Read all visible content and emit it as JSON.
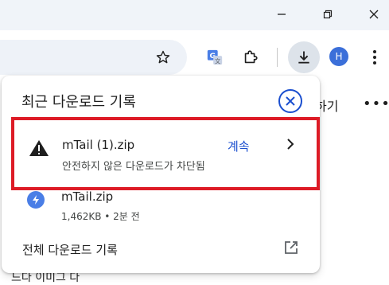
{
  "window": {
    "controls": [
      "minimize",
      "restore",
      "close"
    ]
  },
  "toolbar": {
    "icons": [
      "star-icon",
      "translate-icon",
      "extensions-icon",
      "download-icon",
      "more-icon"
    ],
    "avatar_letter": "H"
  },
  "page": {
    "partial_text": "하기",
    "dots": "•••",
    "bottom_text": "드다 이미그 다"
  },
  "downloads": {
    "title": "최근 다운로드 기록",
    "items": [
      {
        "name": "mTail (1).zip",
        "status": "안전하지 않은 다운로드가 차단됨",
        "action": "계속",
        "icon": "warning-icon",
        "highlighted": true
      },
      {
        "name": "mTail.zip",
        "status": "1,462KB • 2분 전",
        "icon": "zip-file-icon"
      }
    ],
    "footer_label": "전체 다운로드 기록"
  },
  "colors": {
    "accent": "#1b4fcf",
    "highlight_border": "#dd1b26",
    "titlebar": "#f0f4f9"
  }
}
